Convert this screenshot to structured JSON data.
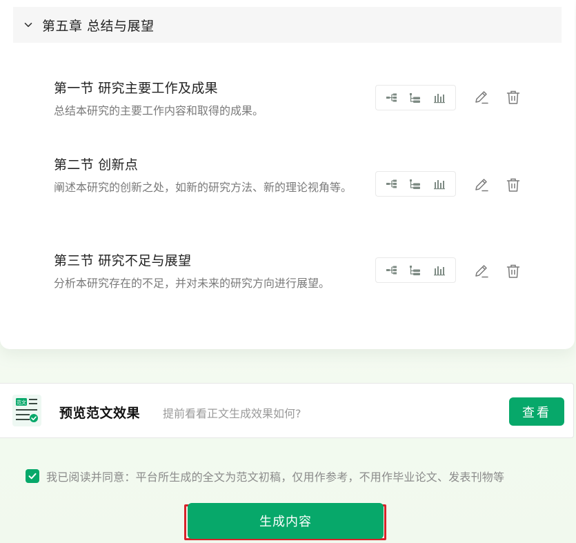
{
  "chapter": {
    "title": "第五章 总结与展望"
  },
  "sections": [
    {
      "title": "第一节 研究主要工作及成果",
      "desc": "总结本研究的主要工作内容和取得的成果。"
    },
    {
      "title": "第二节 创新点",
      "desc": "阐述本研究的创新之处，如新的研究方法、新的理论视角等。"
    },
    {
      "title": "第三节 研究不足与展望",
      "desc": "分析本研究存在的不足，并对未来的研究方向进行展望。"
    }
  ],
  "icons": {
    "tree": "tree-structure-icon",
    "list": "list-outline-icon",
    "chart": "bar-chart-icon",
    "edit": "pencil-icon",
    "delete": "trash-icon",
    "chevron": "chevron-down-icon",
    "preview": "document-check-icon",
    "check": "checkmark-icon"
  },
  "preview": {
    "badge": "范文",
    "title": "预览范文效果",
    "hint": "提前看看正文生成效果如何?",
    "button": "查看"
  },
  "agreement": {
    "checked": true,
    "text": "我已阅读并同意：平台所生成的全文为范文初稿，仅用作参考，不用作毕业论文、发表刊物等"
  },
  "generate": {
    "label": "生成内容"
  },
  "colors": {
    "accent": "#07a86a",
    "highlight": "#d8222a",
    "muted_text": "#7a7a7a"
  }
}
